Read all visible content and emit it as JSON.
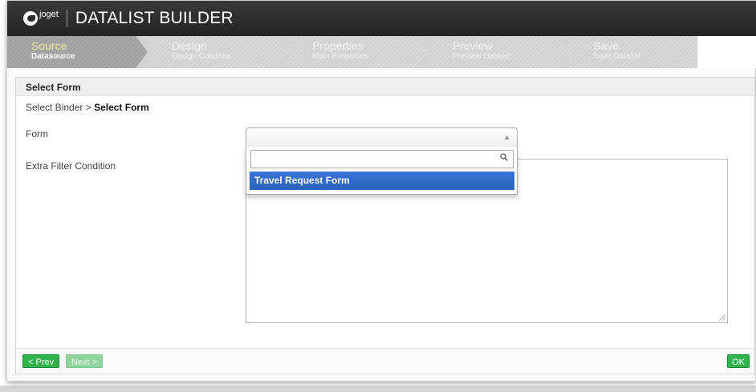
{
  "header": {
    "logo_text": "joget",
    "title": "DATALIST BUILDER"
  },
  "steps": [
    {
      "title": "Source",
      "subtitle": "Datasource"
    },
    {
      "title": "Design",
      "subtitle": "Design Columns"
    },
    {
      "title": "Properties",
      "subtitle": "Main Properties"
    },
    {
      "title": "Preview",
      "subtitle": "Preview Datalist"
    },
    {
      "title": "Save",
      "subtitle": "Save Datalist"
    }
  ],
  "panel": {
    "heading": "Select Form",
    "breadcrumb_prefix": "Select Binder > ",
    "breadcrumb_current": "Select Form",
    "form_label": "Form",
    "filter_label": "Extra Filter Condition",
    "select_value": "",
    "search_value": "",
    "options": [
      "Travel Request Form"
    ],
    "filter_value": ""
  },
  "buttons": {
    "prev": "< Prev",
    "next": "Next >",
    "ok": "OK"
  }
}
